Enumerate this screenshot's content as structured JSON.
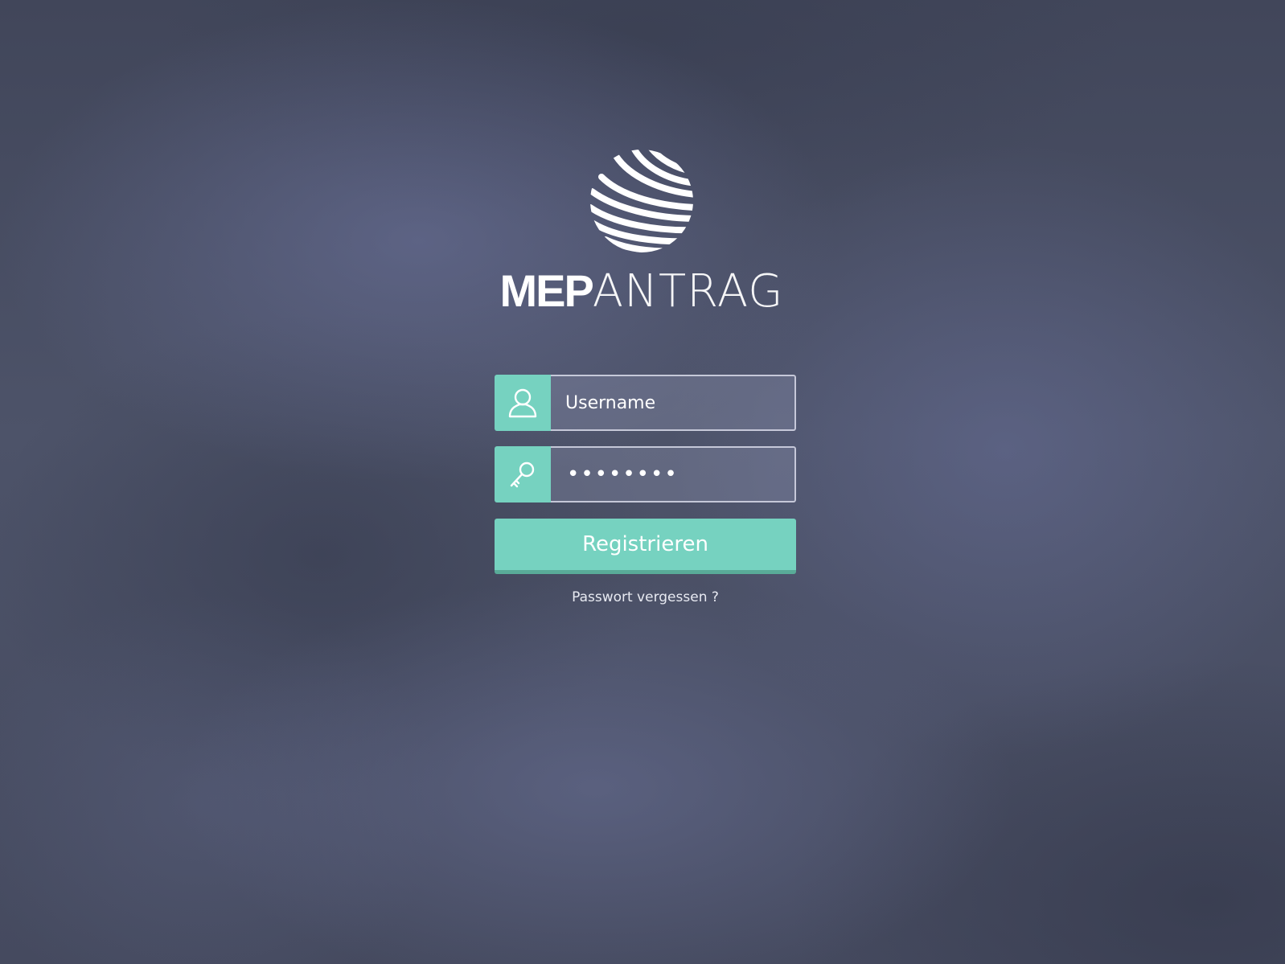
{
  "brand": {
    "logo_icon": "striped-globe-icon",
    "name_bold": "MEP",
    "name_light": "ANTRAG"
  },
  "login": {
    "username": {
      "icon": "user-icon",
      "placeholder": "Username",
      "value": ""
    },
    "password": {
      "icon": "key-icon",
      "masked_value": "••••••••"
    },
    "submit_label": "Registrieren",
    "forgot_label": "Passwort vergessen ?"
  },
  "colors": {
    "accent": "#76d2c0",
    "accent_dark": "#59ab98",
    "background": "#4d5369",
    "text": "#ffffff"
  }
}
